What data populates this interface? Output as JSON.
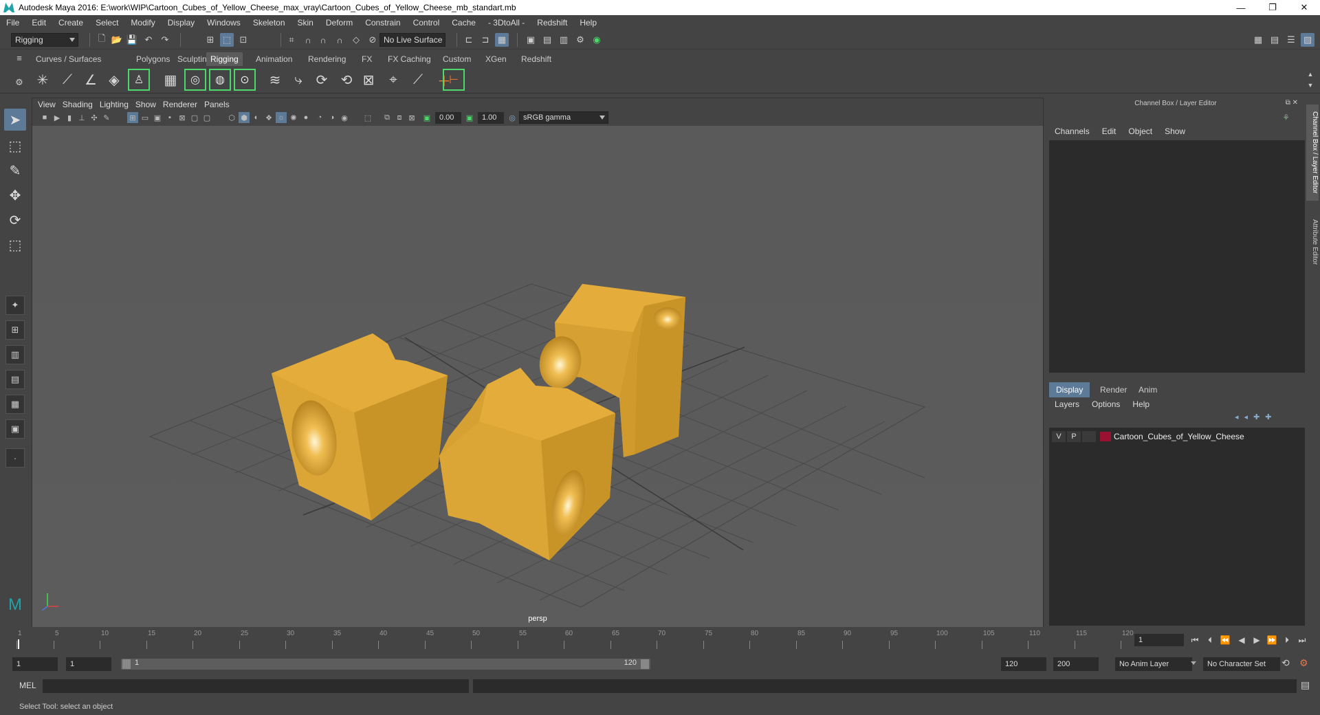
{
  "window": {
    "title": "Autodesk Maya 2016: E:\\work\\WIP\\Cartoon_Cubes_of_Yellow_Cheese_max_vray\\Cartoon_Cubes_of_Yellow_Cheese_mb_standart.mb",
    "minimize": "—",
    "restore": "❐",
    "close": "✕"
  },
  "menubar": [
    "File",
    "Edit",
    "Create",
    "Select",
    "Modify",
    "Display",
    "Windows",
    "Skeleton",
    "Skin",
    "Deform",
    "Constrain",
    "Control",
    "Cache",
    "- 3DtoAll -",
    "Redshift",
    "Help"
  ],
  "statusline": {
    "mode": "Rigging",
    "live_surface": "No Live Surface"
  },
  "shelf": {
    "tabs": [
      "Curves / Surfaces",
      "Polygons",
      "Sculpting",
      "Rigging",
      "Animation",
      "Rendering",
      "FX",
      "FX Caching",
      "Custom",
      "XGen",
      "Redshift"
    ],
    "active_tab": "Rigging"
  },
  "viewport": {
    "menus": [
      "View",
      "Shading",
      "Lighting",
      "Show",
      "Renderer",
      "Panels"
    ],
    "exposure": "0.00",
    "gamma": "1.00",
    "color_space": "sRGB gamma",
    "camera_label": "persp"
  },
  "channelbox": {
    "header": "Channel Box / Layer Editor",
    "menus": [
      "Channels",
      "Edit",
      "Object",
      "Show"
    ]
  },
  "layer_editor": {
    "tabs": [
      "Display",
      "Render",
      "Anim"
    ],
    "active_tab": "Display",
    "menus": [
      "Layers",
      "Options",
      "Help"
    ],
    "layers": [
      {
        "v": "V",
        "p": "P",
        "name": "Cartoon_Cubes_of_Yellow_Cheese",
        "color": "#9b1131"
      }
    ]
  },
  "side_tabs": [
    "Channel Box / Layer Editor",
    "Attribute Editor"
  ],
  "timeslider": {
    "ticks": [
      "1",
      "5",
      "10",
      "15",
      "20",
      "25",
      "30",
      "35",
      "40",
      "45",
      "50",
      "55",
      "60",
      "65",
      "70",
      "75",
      "80",
      "85",
      "90",
      "95",
      "100",
      "105",
      "110",
      "115",
      "120"
    ],
    "current_frame": "1"
  },
  "range": {
    "start": "1",
    "playback_start": "1",
    "slider_start": "1",
    "slider_end": "120",
    "playback_end": "120",
    "end": "200",
    "anim_layer": "No Anim Layer",
    "character_set": "No Character Set"
  },
  "command": {
    "label": "MEL"
  },
  "helpline": {
    "text": "Select Tool: select an object"
  },
  "colors": {
    "cheese": "#e0a93a",
    "accent": "#5d7a99",
    "layer_color": "#9b1131"
  }
}
